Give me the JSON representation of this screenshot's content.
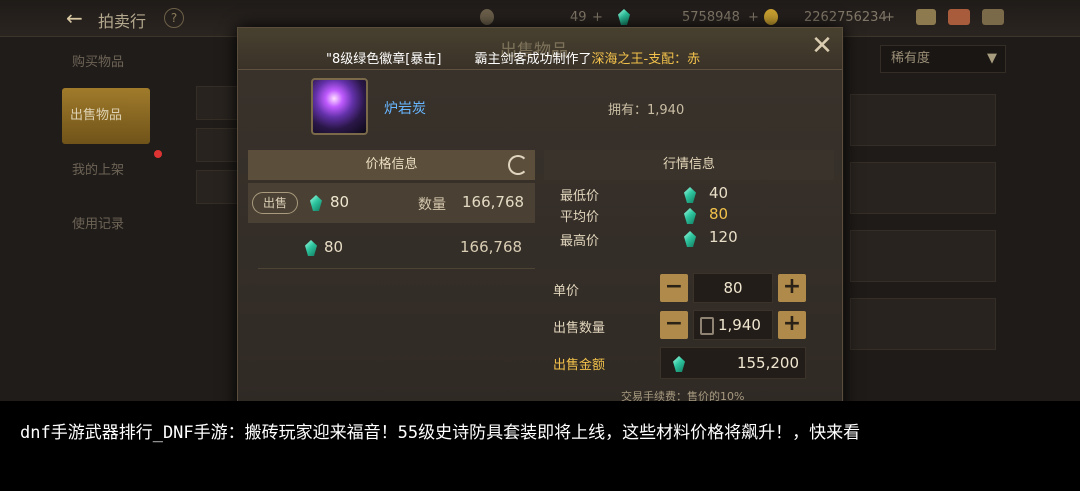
{
  "topbar": {
    "title": "拍卖行",
    "help": "?",
    "currency1": "49",
    "currency2": "5758948",
    "currency3": "2262756234",
    "plus": "+"
  },
  "sidebar": {
    "items": [
      {
        "label": "购买物品"
      },
      {
        "label": "出售物品"
      },
      {
        "label": "我的上架"
      },
      {
        "label": "使用记录"
      }
    ]
  },
  "right": {
    "rarity_label": "稀有度",
    "rarity_arrow": "▼"
  },
  "dialog": {
    "title": "出售物品",
    "ticker_prefix": "\"8级绿色徽章[暴击]",
    "ticker_mid": "霸主剑客成功制作了",
    "ticker_item": "深海之王-支配：赤",
    "close": "✕",
    "item_name": "炉岩炭",
    "owned": "拥有：1,940",
    "price_info": {
      "header": "价格信息",
      "rows": [
        {
          "action": "出售",
          "price": "80",
          "qty_label": "数量",
          "qty": "166,768"
        },
        {
          "price": "80",
          "qty": "166,768"
        }
      ]
    },
    "market_info": {
      "header": "行情信息",
      "rows": [
        {
          "label": "最低价",
          "value": "40",
          "color": "#e8ddc6"
        },
        {
          "label": "平均价",
          "value": "80",
          "color": "#f2c14b"
        },
        {
          "label": "最高价",
          "value": "120",
          "color": "#e8ddc6"
        }
      ]
    },
    "form": {
      "unit_label": "单价",
      "unit_value": "80",
      "qty_label": "出售数量",
      "qty_value": "1,940",
      "total_label": "出售金额",
      "total_value": "155,200",
      "minus": "−",
      "plus": "+",
      "fee": "交易手续费：售价的10%"
    }
  },
  "caption": "dnf手游武器排行_DNF手游：搬砖玩家迎来福音！55级史诗防具套装即将上线，这些材料价格将飙升！，快来看"
}
